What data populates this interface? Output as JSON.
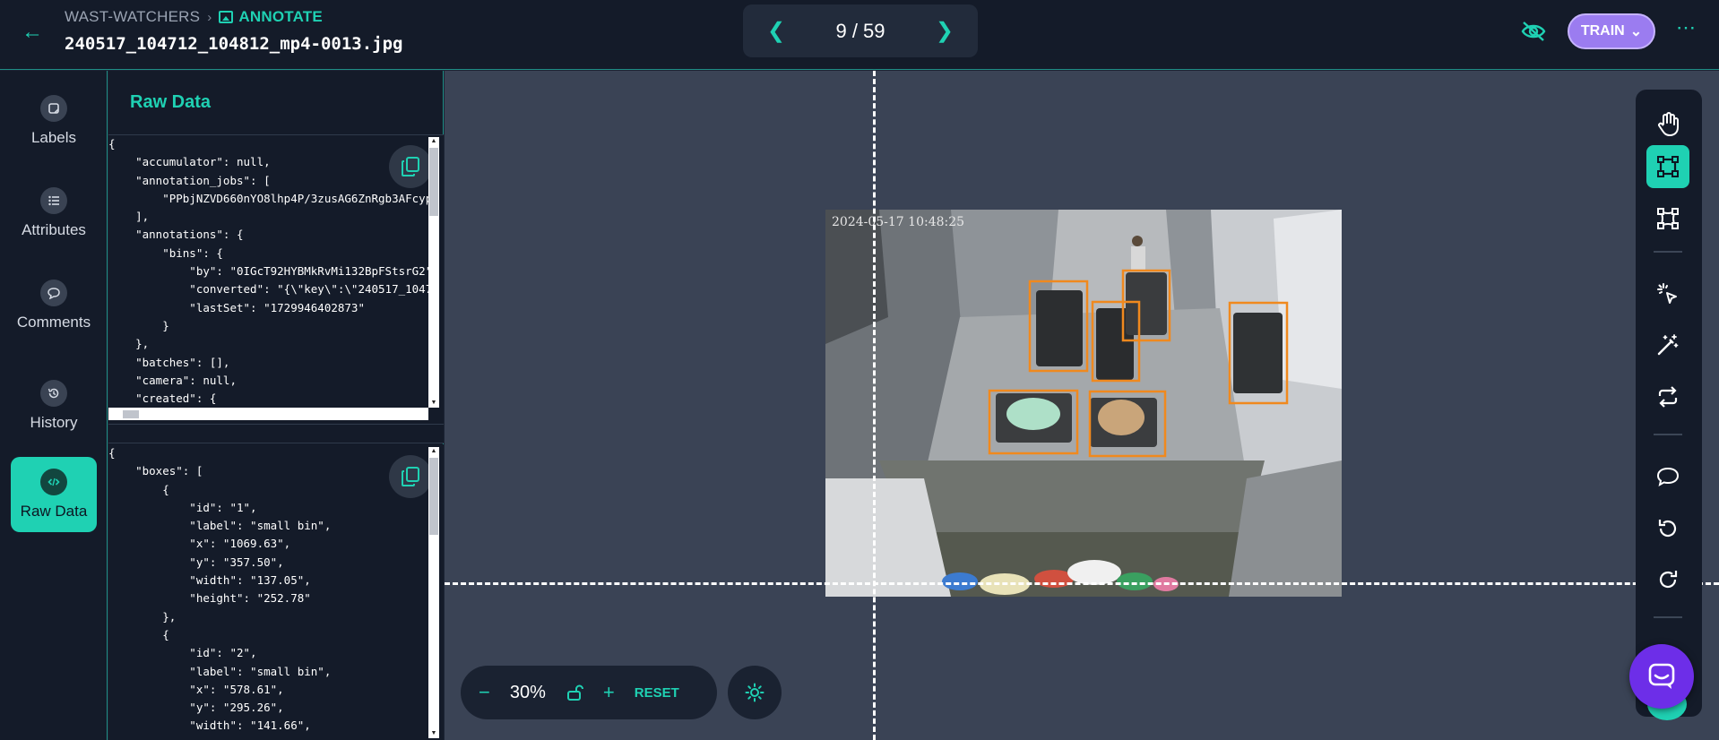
{
  "header": {
    "project": "WAST-WATCHERS",
    "section": "ANNOTATE",
    "filename": "240517_104712_104812_mp4-0013.jpg",
    "pager": "9 / 59",
    "train_label": "TRAIN"
  },
  "nav": {
    "items": [
      {
        "label": "Labels",
        "icon": "tag-icon"
      },
      {
        "label": "Attributes",
        "icon": "list-icon"
      },
      {
        "label": "Comments",
        "icon": "comment-icon"
      },
      {
        "label": "History",
        "icon": "history-icon"
      },
      {
        "label": "Raw Data",
        "icon": "code-icon",
        "active": true
      }
    ]
  },
  "raw_data": {
    "title": "Raw Data",
    "item_json": "{\n    \"accumulator\": null,\n    \"annotation_jobs\": [\n        \"PPbjNZVD660nYO8lhp4P/3zusAG6ZnRgb3AFcyp\n    ],\n    \"annotations\": {\n        \"bins\": {\n            \"by\": \"0IGcT92HYBMkRvMi132BpFStsrG2\"\n            \"converted\": \"{\\\"key\\\":\\\"240517_1047\n            \"lastSet\": \"1729946402873\"\n        }\n    },\n    \"batches\": [],\n    \"camera\": null,\n    \"created\": {",
    "boxes_json": "{\n    \"boxes\": [\n        {\n            \"id\": \"1\",\n            \"label\": \"small bin\",\n            \"x\": \"1069.63\",\n            \"y\": \"357.50\",\n            \"width\": \"137.05\",\n            \"height\": \"252.78\"\n        },\n        {\n            \"id\": \"2\",\n            \"label\": \"small bin\",\n            \"x\": \"578.61\",\n            \"y\": \"295.26\",\n            \"width\": \"141.66\","
  },
  "image": {
    "timestamp": "2024-05-17 10:48:25"
  },
  "zoom": {
    "value": "30%",
    "reset_label": "RESET"
  },
  "colors": {
    "accent": "#1fd1b3",
    "box": "#f0891e",
    "train": "#9b7cf0",
    "chat": "#6d2ee8"
  }
}
